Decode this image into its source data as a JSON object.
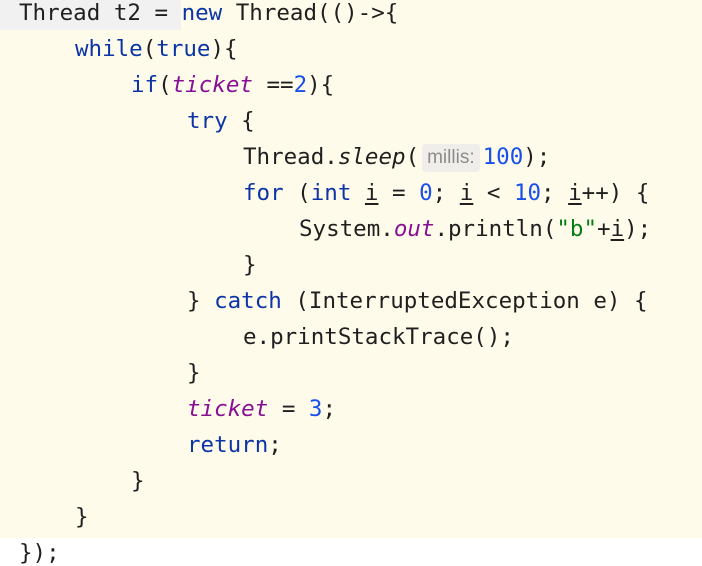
{
  "code": {
    "l1": {
      "a": "Thread t2 = ",
      "kw": "new",
      "b": " Thread(()->{"
    },
    "l2": {
      "kw": "while",
      "a": "(",
      "val": "true",
      "b": "){"
    },
    "l3": {
      "kw": "if",
      "a": "(",
      "field": "ticket",
      "b": " ==",
      "num": "2",
      "c": "){"
    },
    "l4": {
      "kw": "try",
      "a": " {"
    },
    "l5": {
      "a": "Thread.",
      "method": "sleep",
      "b": "(",
      "hint": "millis:",
      "num": "100",
      "c": ");"
    },
    "l6": {
      "kw_for": "for",
      "a": " (",
      "kw_int": "int",
      "b": " ",
      "var1": "i",
      "c": " = ",
      "num0": "0",
      "d": "; ",
      "var2": "i",
      "e": " < ",
      "num10": "10",
      "f": "; ",
      "var3": "i",
      "g": "++) {"
    },
    "l7": {
      "a": "System.",
      "out": "out",
      "b": ".println(",
      "str": "\"b\"",
      "c": "+",
      "var": "i",
      "d": ");"
    },
    "l8": {
      "a": "}"
    },
    "l9": {
      "a": "} ",
      "kw": "catch",
      "b": " (InterruptedException e) {"
    },
    "l10": {
      "a": "e.printStackTrace();"
    },
    "l11": {
      "a": "}"
    },
    "l12": {
      "field": "ticket",
      "a": " = ",
      "num": "3",
      "b": ";"
    },
    "l13": {
      "kw": "return",
      "a": ";"
    },
    "l14": {
      "a": "}"
    },
    "l15": {
      "a": "}"
    },
    "l16": {
      "a": "});"
    }
  }
}
